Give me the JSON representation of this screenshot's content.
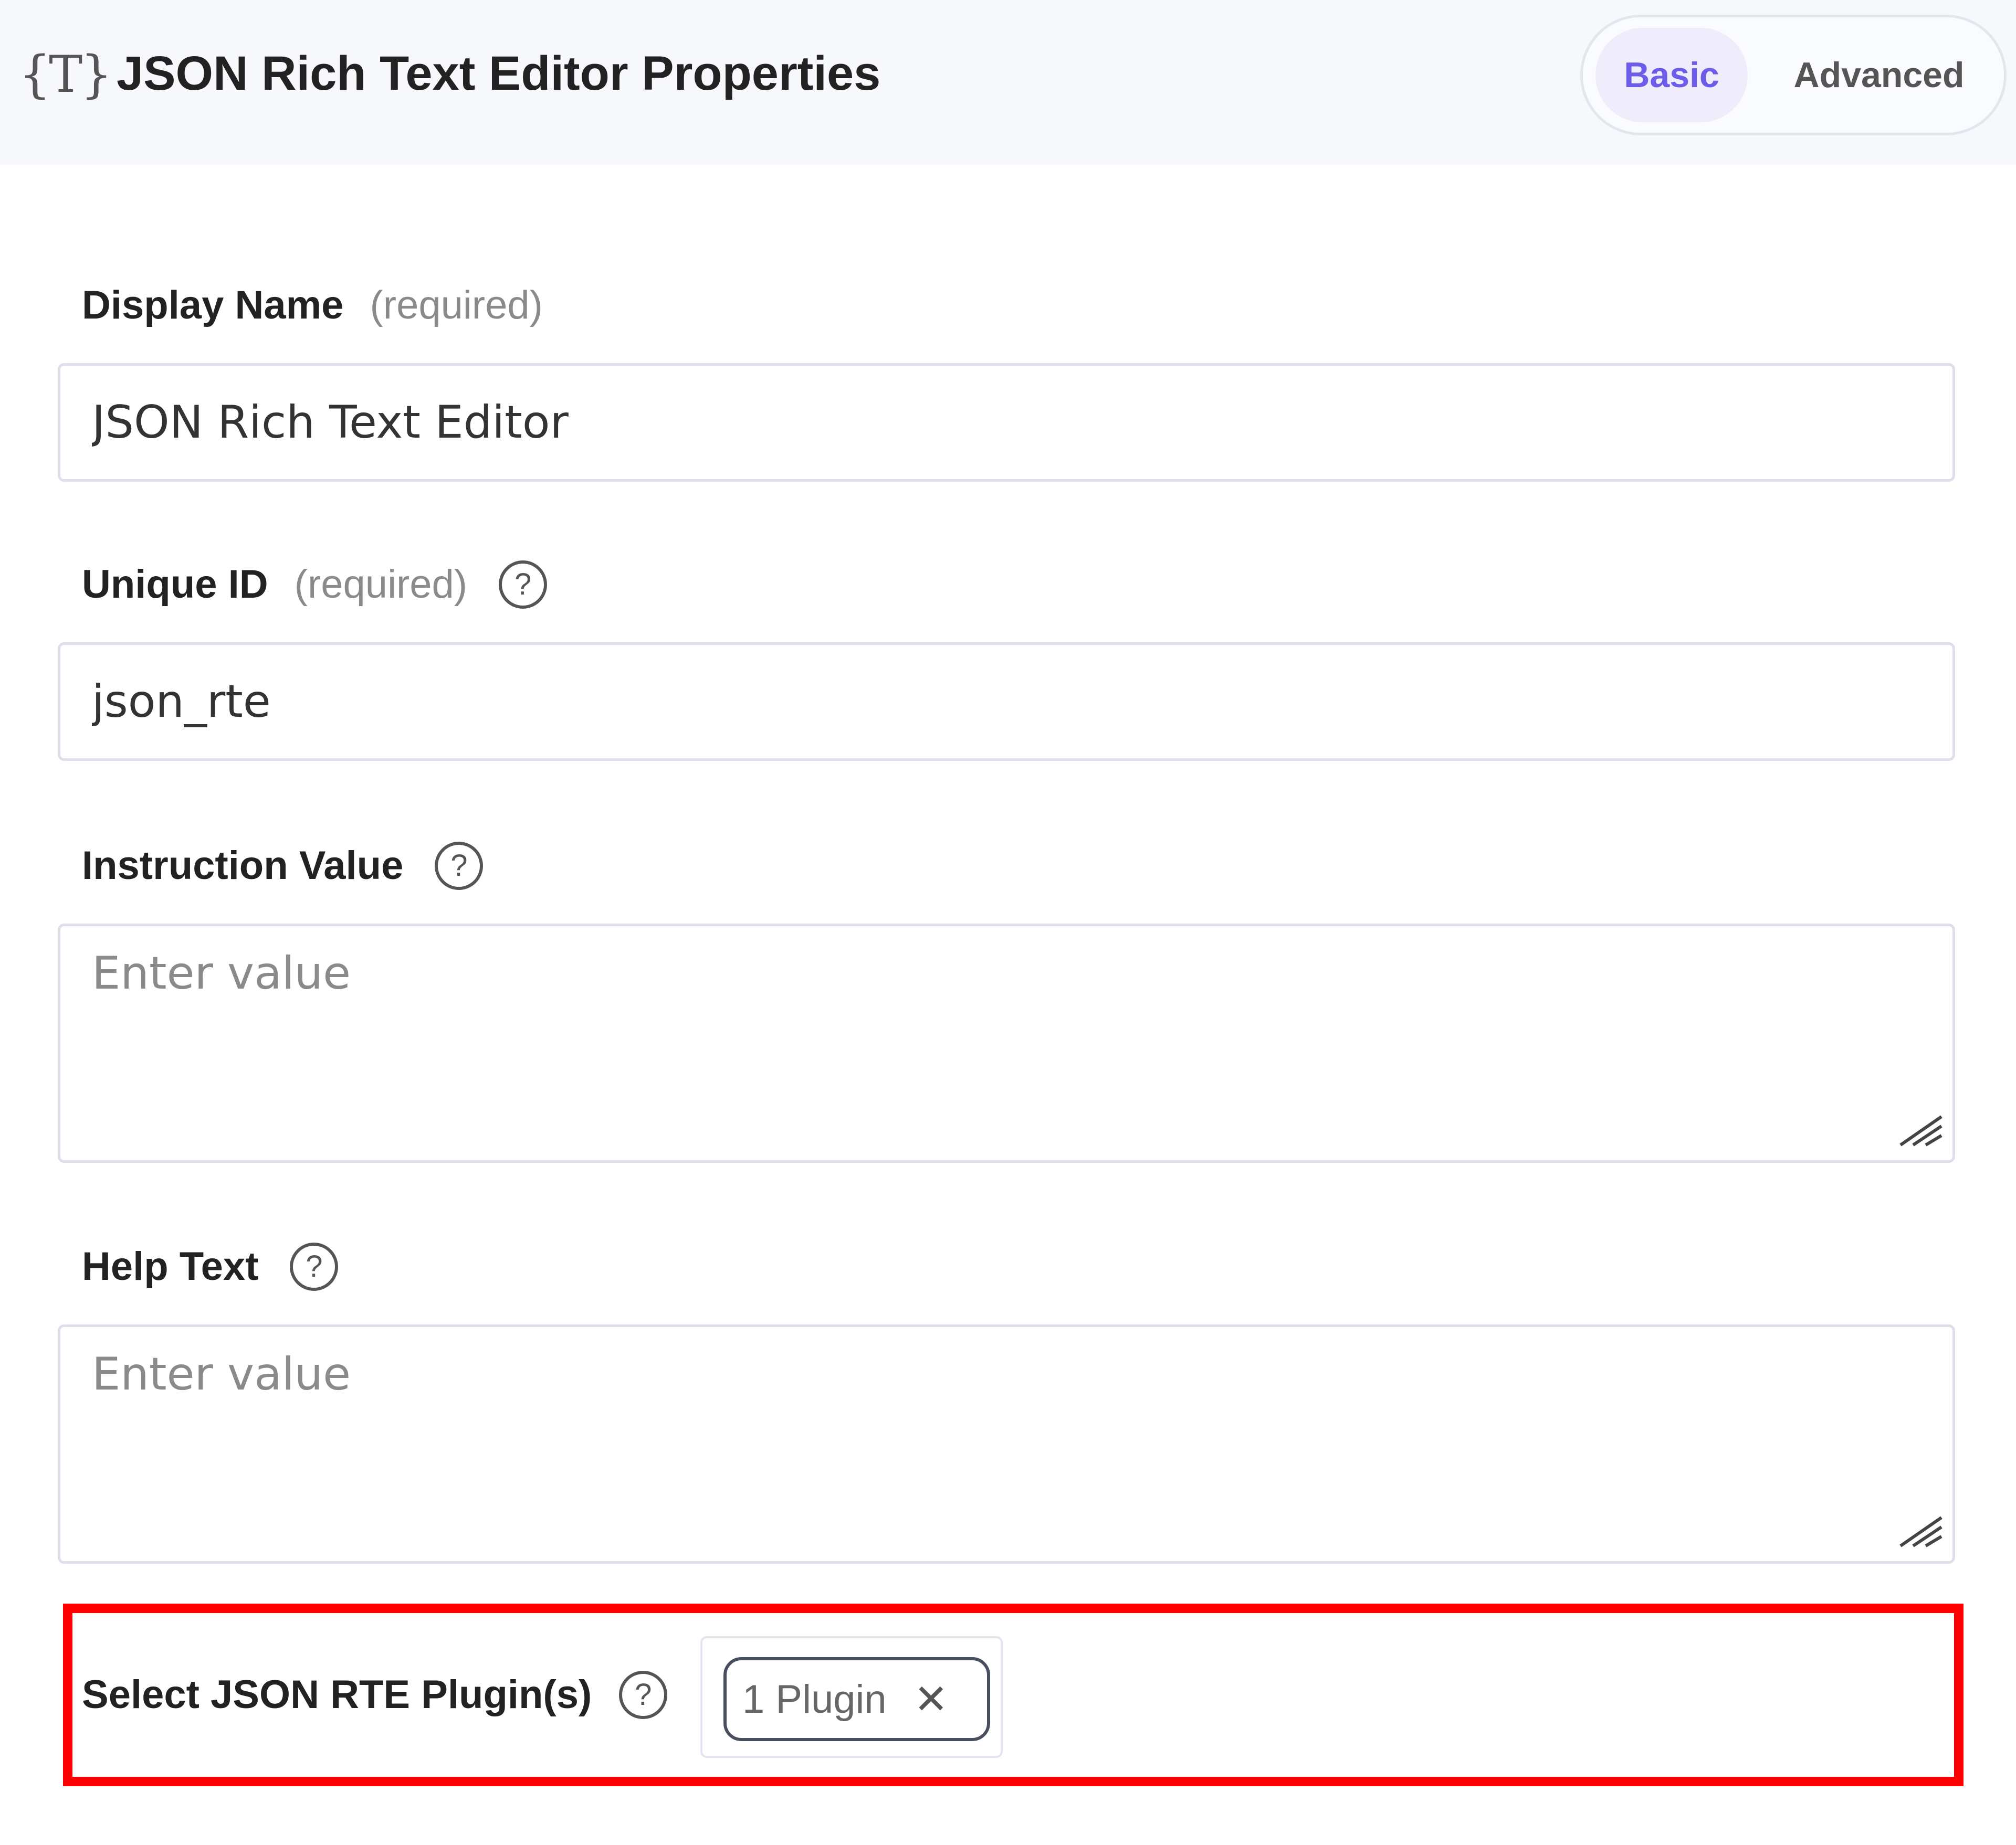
{
  "header": {
    "icon": "{T}",
    "title": "JSON Rich Text Editor Properties",
    "tabs": [
      {
        "label": "Basic",
        "active": true
      },
      {
        "label": "Advanced",
        "active": false
      }
    ]
  },
  "fields": {
    "display_name": {
      "label": "Display Name",
      "required_text": "(required)",
      "value": "JSON Rich Text Editor"
    },
    "unique_id": {
      "label": "Unique ID",
      "required_text": "(required)",
      "value": "json_rte"
    },
    "instruction_value": {
      "label": "Instruction Value",
      "placeholder": "Enter value"
    },
    "help_text": {
      "label": "Help Text",
      "placeholder": "Enter value"
    },
    "plugins": {
      "label": "Select JSON RTE Plugin(s)",
      "chip_label": "1 Plugin",
      "chip_close": "✕"
    }
  },
  "help_icon_glyph": "?",
  "colors": {
    "accent": "#6c5ce7",
    "highlight": "#ff0000",
    "header_bg": "#f7f8fc",
    "border": "#dde0ea"
  },
  "icons": [
    "template-text-icon",
    "help-icon",
    "close-icon",
    "resize-handle-icon"
  ]
}
